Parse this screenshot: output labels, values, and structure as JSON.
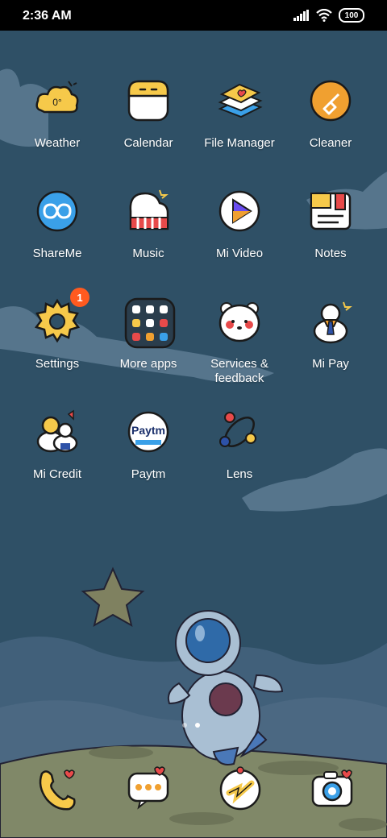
{
  "status_bar": {
    "time": "2:36 AM",
    "battery": "100"
  },
  "apps": [
    {
      "label": "Weather",
      "icon": "weather-cloud-icon",
      "icon_text": "0°"
    },
    {
      "label": "Calendar",
      "icon": "calendar-icon"
    },
    {
      "label": "File Manager",
      "icon": "file-manager-books-icon"
    },
    {
      "label": "Cleaner",
      "icon": "cleaner-broom-icon"
    },
    {
      "label": "ShareMe",
      "icon": "shareme-infinity-icon"
    },
    {
      "label": "Music",
      "icon": "music-piano-icon"
    },
    {
      "label": "Mi Video",
      "icon": "mi-video-play-icon"
    },
    {
      "label": "Notes",
      "icon": "notes-icon"
    },
    {
      "label": "Settings",
      "icon": "settings-gear-icon",
      "badge": "1"
    },
    {
      "label": "More apps",
      "icon": "more-apps-folder-icon"
    },
    {
      "label": "Services & feedback",
      "icon": "services-bear-icon"
    },
    {
      "label": "Mi Pay",
      "icon": "mi-pay-icon"
    },
    {
      "label": "Mi Credit",
      "icon": "mi-credit-icon"
    },
    {
      "label": "Paytm",
      "icon": "paytm-icon",
      "icon_text": "Paytm"
    },
    {
      "label": "Lens",
      "icon": "lens-icon"
    }
  ],
  "dock": [
    {
      "icon": "phone-icon"
    },
    {
      "icon": "messages-icon"
    },
    {
      "icon": "browser-icon"
    },
    {
      "icon": "camera-icon"
    }
  ],
  "page_indicator": {
    "pages": 2,
    "active": 2
  },
  "colors": {
    "background": "#2f5066",
    "badge": "#ff5a1f",
    "icon_yellow": "#f6c94a",
    "icon_orange": "#f0a030",
    "icon_blue": "#3aa0e8"
  }
}
